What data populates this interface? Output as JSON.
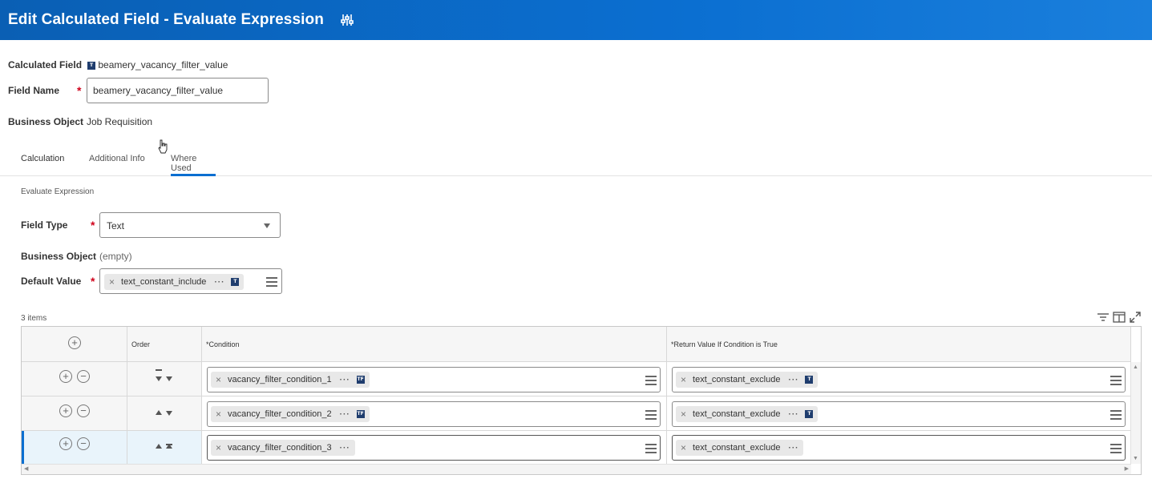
{
  "header": {
    "title": "Edit Calculated Field - Evaluate Expression",
    "icon": "sliders-icon"
  },
  "calculated_field": {
    "label": "Calculated Field",
    "type_badge": "T",
    "value": "beamery_vacancy_filter_value"
  },
  "field_name": {
    "label": "Field Name",
    "value": "beamery_vacancy_filter_value"
  },
  "business_object": {
    "label": "Business Object",
    "value": "Job Requisition"
  },
  "tabs": [
    {
      "label": "Calculation",
      "active": true
    },
    {
      "label": "Additional Info",
      "active": false
    },
    {
      "label": "Where Used",
      "active": false
    }
  ],
  "section": {
    "title": "Evaluate Expression"
  },
  "field_type": {
    "label": "Field Type",
    "value": "Text"
  },
  "bo2": {
    "label": "Business Object",
    "value": "(empty)"
  },
  "default_value": {
    "label": "Default Value",
    "value": "text_constant_include",
    "type_badge": "T"
  },
  "grid": {
    "count": "3 items",
    "columns": {
      "order": "Order",
      "condition": "*Condition",
      "return": "*Return Value If Condition is True"
    },
    "rows": [
      {
        "condition": "vacancy_filter_condition_1",
        "condition_badge": "TF",
        "return": "text_constant_exclude",
        "return_badge": "T"
      },
      {
        "condition": "vacancy_filter_condition_2",
        "condition_badge": "TF",
        "return": "text_constant_exclude",
        "return_badge": "T"
      },
      {
        "condition": "vacancy_filter_condition_3",
        "return": "text_constant_exclude"
      }
    ]
  },
  "colors": {
    "header_blue": "#0b6fd1",
    "required_red": "#d0021b",
    "selected_row": "#e9f4fb",
    "selected_border": "#0b6fd1"
  }
}
